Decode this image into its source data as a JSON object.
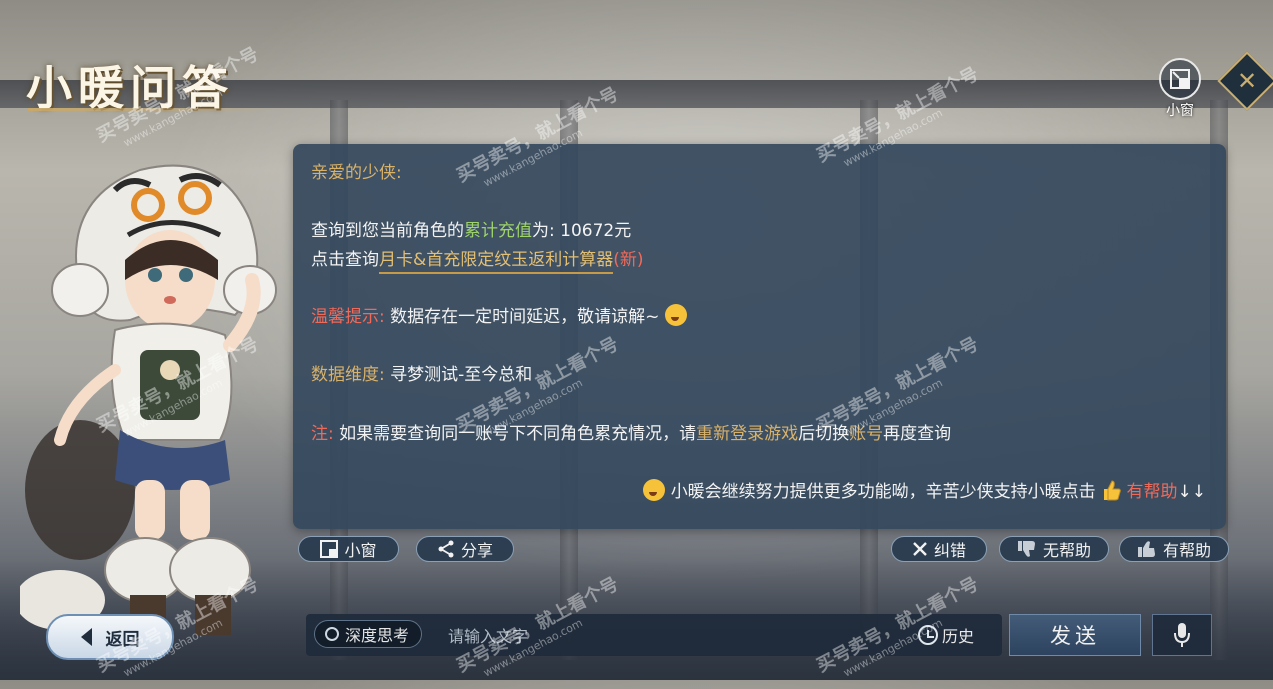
{
  "app": {
    "title": "小暖问答",
    "mini_window_label": "小窗"
  },
  "panel": {
    "greeting": "亲爱的少侠:",
    "recharge_prefix": "查询到您当前角色的",
    "recharge_label": "累计充值",
    "recharge_mid": "为: ",
    "recharge_value": "10672元",
    "query_prefix": "点击查询",
    "query_link": "月卡&首充限定纹玉返利计算器",
    "query_suffix": "(新)",
    "tip_label": "温馨提示:",
    "tip_text": " 数据存在一定时间延迟，敬请谅解~",
    "dimension_label": "数据维度:",
    "dimension_text": " 寻梦测试-至今总和",
    "note_label": "注:",
    "note_text_1": " 如果需要查询同一账号下不同角色累充情况，请",
    "note_link_1": "重新登录游戏",
    "note_text_2": "后切换",
    "note_link_2": "账号",
    "note_text_3": "再度查询",
    "footer_text": "小暖会继续努力提供更多功能呦，辛苦少侠支持小暖点击",
    "footer_helpful": "有帮助",
    "footer_arrows": "↓↓"
  },
  "actions": {
    "mini_window": "小窗",
    "share": "分享",
    "correct": "纠错",
    "not_helpful": "无帮助",
    "helpful": "有帮助"
  },
  "bottom": {
    "back": "返回",
    "deep_think": "深度思考",
    "input_placeholder": "请输入文字",
    "history": "历史",
    "send": "发送"
  },
  "watermark": {
    "main": "买号卖号，就上看个号",
    "url": "www.kangehao.com",
    "badge": "看个号"
  },
  "colors": {
    "panel_bg": "#34485c",
    "gold": "#d9b26a",
    "green": "#9ed46a",
    "red": "#f06a5a"
  }
}
